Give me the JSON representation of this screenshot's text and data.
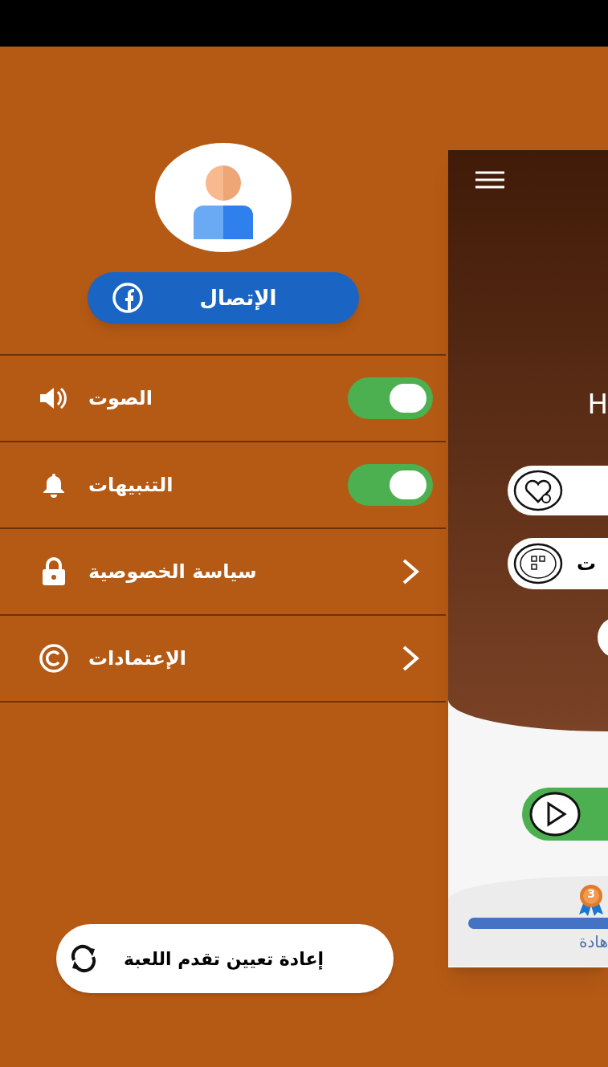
{
  "drawer": {
    "login_button": {
      "label": "الإتصال"
    },
    "settings": [
      {
        "kind": "toggle",
        "label": "الصوت",
        "on": true
      },
      {
        "kind": "toggle",
        "label": "التنبيهات",
        "on": true
      },
      {
        "kind": "link",
        "label": "سياسة الخصوصية"
      },
      {
        "kind": "link",
        "label": "الإعتمادات"
      }
    ],
    "reset_button": {
      "label": "إعادة تعيين تقدم اللعبة"
    }
  },
  "main_screen": {
    "title": "H",
    "category_button": {
      "label": "ت"
    },
    "medal": {
      "number": "3"
    },
    "certificate_label": "هادة"
  }
}
